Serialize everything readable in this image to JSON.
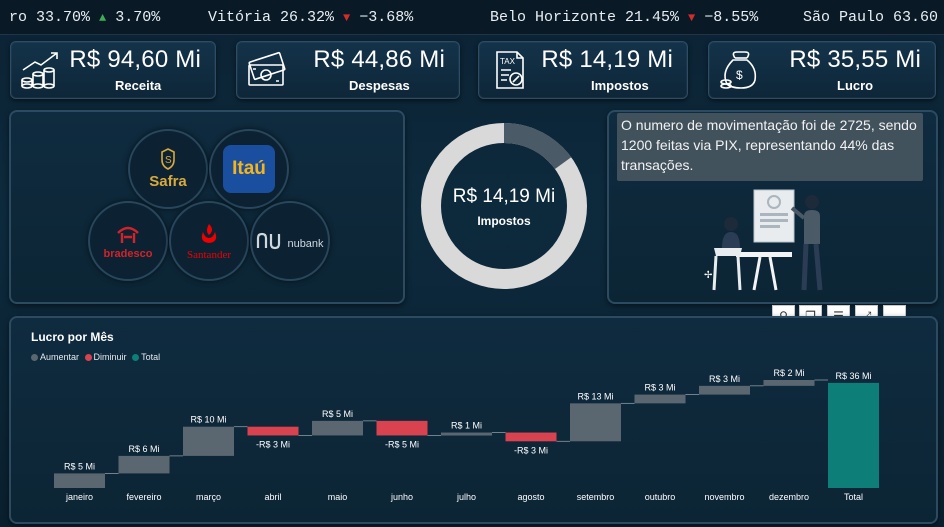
{
  "ticker": {
    "items": [
      {
        "text": "ro 33.70%",
        "dir": "up",
        "arrow": "▲",
        "change": "3.70%"
      },
      {
        "text": "Vitória 26.32%",
        "dir": "down",
        "arrow": "▼",
        "change": "−3.68%"
      },
      {
        "text": "Belo Horizonte 21.45%",
        "dir": "down",
        "arrow": "▼",
        "change": "−8.55%"
      },
      {
        "text": "São Paulo 63.60",
        "dir": "",
        "arrow": "",
        "change": ""
      }
    ]
  },
  "kpis": {
    "receita": {
      "value": "R$ 94,60 Mi",
      "label": "Receita",
      "icon": "growth-coins-icon"
    },
    "despesas": {
      "value": "R$ 44,86 Mi",
      "label": "Despesas",
      "icon": "money-bill-icon"
    },
    "impostos": {
      "value": "R$ 14,19 Mi",
      "label": "Impostos",
      "icon": "tax-document-icon"
    },
    "lucro": {
      "value": "R$ 35,55 Mi",
      "label": "Lucro",
      "icon": "money-bag-icon"
    }
  },
  "banks": [
    {
      "name": "Safra",
      "icon": "safra-logo"
    },
    {
      "name": "Itaú",
      "icon": "itau-logo"
    },
    {
      "name": "bradesco",
      "icon": "bradesco-logo"
    },
    {
      "name": "Santander",
      "icon": "santander-logo"
    },
    {
      "name": "nubank",
      "icon": "nubank-logo"
    }
  ],
  "donut": {
    "value": "R$ 14,19 Mi",
    "label": "Impostos",
    "fraction": 0.15,
    "color_main": "#d9d9d9",
    "color_part": "#4a5a66"
  },
  "insight": {
    "text": "O numero de movimentação foi de 2725, sendo 1200 feitas via PIX, representando 44% das transações."
  },
  "toolbar": {
    "pin": "pin-icon",
    "copy": "copy-icon",
    "filter": "filter-icon",
    "focus": "focus-mode-icon",
    "more": "more-options-icon"
  },
  "chart": {
    "title": "Lucro por Mês",
    "legend": [
      {
        "label": "Aumentar",
        "color": "#5b6770"
      },
      {
        "label": "Diminuir",
        "color": "#d9434f"
      },
      {
        "label": "Total",
        "color": "#0d7f78"
      }
    ]
  },
  "chart_data": {
    "type": "waterfall",
    "title": "Lucro por Mês",
    "categories": [
      "janeiro",
      "fevereiro",
      "março",
      "abril",
      "maio",
      "junho",
      "julho",
      "agosto",
      "setembro",
      "outubro",
      "novembro",
      "dezembro",
      "Total"
    ],
    "values": [
      5,
      6,
      10,
      -3,
      5,
      -5,
      1,
      -3,
      13,
      3,
      3,
      2,
      36
    ],
    "labels": [
      "R$ 5 Mi",
      "R$ 6 Mi",
      "R$ 10 Mi",
      "-R$ 3 Mi",
      "R$ 5 Mi",
      "-R$ 5 Mi",
      "R$ 1 Mi",
      "-R$ 3 Mi",
      "R$ 13 Mi",
      "R$ 3 Mi",
      "R$ 3 Mi",
      "R$ 2 Mi",
      "R$ 36 Mi"
    ],
    "ylim": [
      0,
      37
    ],
    "legend_position": "top-left"
  }
}
